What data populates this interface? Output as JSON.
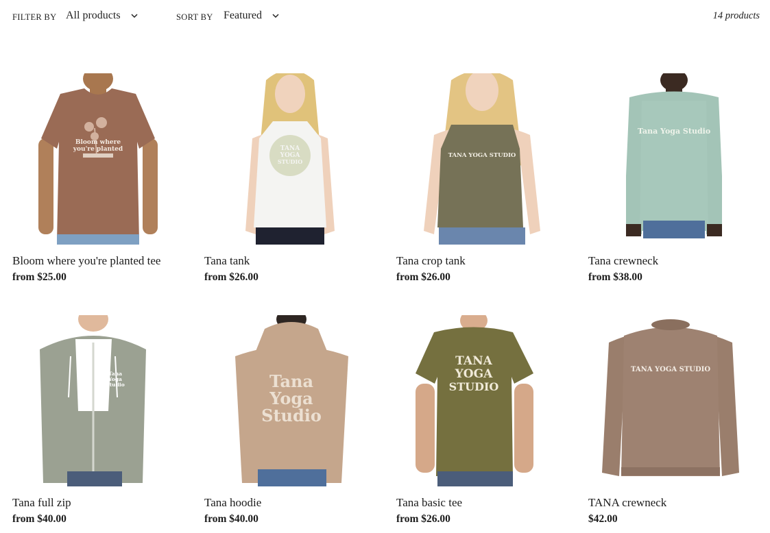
{
  "filter": {
    "label": "FILTER BY",
    "value": "All products"
  },
  "sort": {
    "label": "SORT BY",
    "value": "Featured"
  },
  "product_count": "14 products",
  "products": [
    {
      "name": "Bloom where you're planted tee",
      "price": "from $25.00",
      "print": [
        "Bloom where",
        "you're planted"
      ],
      "color": "#9a6b55"
    },
    {
      "name": "Tana tank",
      "price": "from $26.00",
      "print": [
        "TANA",
        "YOGA",
        "STUDIO"
      ],
      "color": "#f4f4f2"
    },
    {
      "name": "Tana crop tank",
      "price": "from $26.00",
      "print": [
        "TANA YOGA STUDIO"
      ],
      "color": "#767257"
    },
    {
      "name": "Tana crewneck",
      "price": "from $38.00",
      "print": [
        "Tana Yoga Studio"
      ],
      "color": "#a3c4b7"
    },
    {
      "name": "Tana full zip",
      "price": "from $40.00",
      "print": [
        "Tana",
        "Yoga",
        "Studio"
      ],
      "color": "#9ba192"
    },
    {
      "name": "Tana hoodie",
      "price": "from $40.00",
      "print": [
        "Tana",
        "Yoga",
        "Studio"
      ],
      "color": "#c5a68c"
    },
    {
      "name": "Tana basic tee",
      "price": "from $26.00",
      "print": [
        "TANA",
        "YOGA",
        "STUDIO"
      ],
      "color": "#75703f"
    },
    {
      "name": "TANA crewneck",
      "price": "$42.00",
      "print": [
        "TANA YOGA STUDIO"
      ],
      "color": "#9a7e6c"
    }
  ]
}
